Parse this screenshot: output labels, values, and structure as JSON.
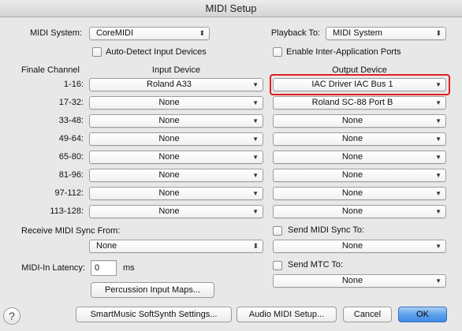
{
  "window": {
    "title": "MIDI Setup"
  },
  "midi_system": {
    "label": "MIDI System:",
    "value": "CoreMIDI",
    "auto_detect_label": "Auto-Detect Input Devices",
    "auto_detect_checked": false
  },
  "playback": {
    "label": "Playback To:",
    "value": "MIDI System",
    "inter_app_label": "Enable Inter-Application Ports",
    "inter_app_checked": false
  },
  "table": {
    "headers": {
      "channel": "Finale Channel",
      "input": "Input Device",
      "output": "Output Device"
    },
    "rows": [
      {
        "channel": "1-16:",
        "input": "Roland A33",
        "output": "IAC Driver IAC Bus 1"
      },
      {
        "channel": "17-32:",
        "input": "None",
        "output": "Roland SC-88 Port B"
      },
      {
        "channel": "33-48:",
        "input": "None",
        "output": "None"
      },
      {
        "channel": "49-64:",
        "input": "None",
        "output": "None"
      },
      {
        "channel": "65-80:",
        "input": "None",
        "output": "None"
      },
      {
        "channel": "81-96:",
        "input": "None",
        "output": "None"
      },
      {
        "channel": "97-112:",
        "input": "None",
        "output": "None"
      },
      {
        "channel": "113-128:",
        "input": "None",
        "output": "None"
      }
    ]
  },
  "receive_sync": {
    "label": "Receive MIDI Sync From:",
    "value": "None"
  },
  "send_sync": {
    "label": "Send MIDI Sync To:",
    "value": "None",
    "checked": false
  },
  "send_mtc": {
    "label": "Send MTC To:",
    "value": "None",
    "checked": false
  },
  "latency": {
    "label": "MIDI-In Latency:",
    "value": "0",
    "unit": "ms"
  },
  "buttons": {
    "percussion": "Percussion Input Maps...",
    "smartmusic": "SmartMusic SoftSynth Settings...",
    "audio_midi": "Audio MIDI Setup...",
    "cancel": "Cancel",
    "ok": "OK",
    "help": "?"
  },
  "colors": {
    "highlight": "#e02020",
    "default_button": "#5ea1ec"
  }
}
